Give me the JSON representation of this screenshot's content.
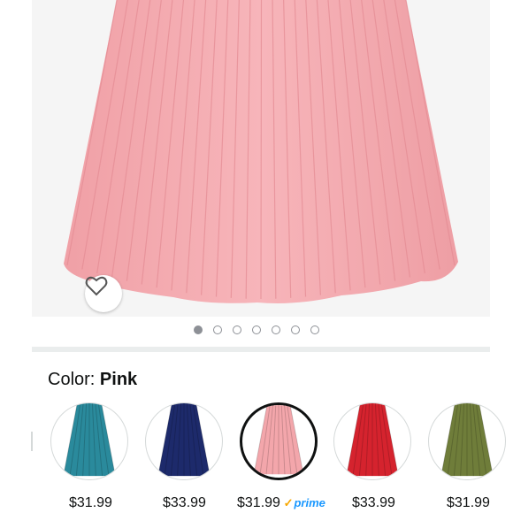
{
  "gallery": {
    "dots_total": 7,
    "active_index": 0,
    "icon": "heart-outline-icon"
  },
  "color_selector": {
    "label_prefix": "Color:",
    "selected_name": "Pink",
    "swatches": [
      {
        "color": "#2a8a9c",
        "price": "$31.99",
        "prime": false
      },
      {
        "color": "#1d2a6b",
        "price": "$33.99",
        "prime": false
      },
      {
        "color": "#f3a6ab",
        "price": "$31.99",
        "prime": true,
        "selected": true
      },
      {
        "color": "#d5232e",
        "price": "$33.99",
        "prime": false
      },
      {
        "color": "#6f7d3a",
        "price": "$31.99",
        "prime": false
      }
    ],
    "prime_badge": "prime"
  },
  "colors": {
    "skirt_pink": "#f4a9ae",
    "prime_blue": "#1a98ff",
    "prime_check": "#f7a700"
  }
}
